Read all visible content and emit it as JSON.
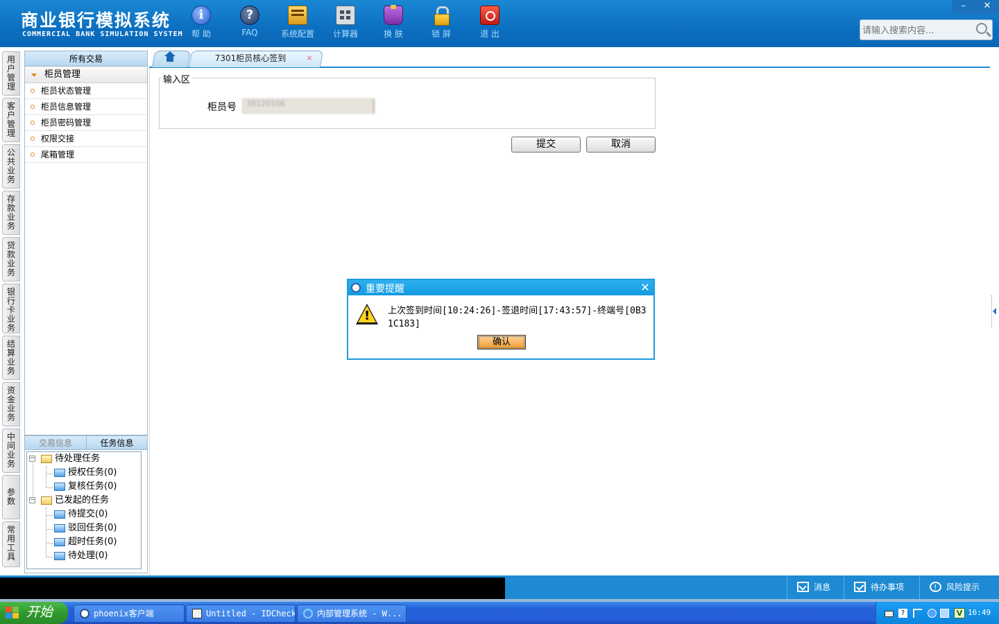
{
  "header": {
    "logo_cn": "商业银行模拟系统",
    "logo_en": "COMMERCIAL BANK SIMULATION SYSTEM",
    "toolbar": [
      {
        "label": "帮 助",
        "icon": "info-icon"
      },
      {
        "label": "FAQ",
        "icon": "faq-icon"
      },
      {
        "label": "系统配置",
        "icon": "config-icon"
      },
      {
        "label": "计算器",
        "icon": "calculator-icon"
      },
      {
        "label": "换 肤",
        "icon": "skin-icon"
      },
      {
        "label": "锁 屏",
        "icon": "lock-icon"
      },
      {
        "label": "退 出",
        "icon": "exit-icon"
      }
    ],
    "window_min": "–",
    "window_close": "✕",
    "search_placeholder": "请输入搜索内容..."
  },
  "vnav": [
    "用户管理",
    "客户管理",
    "公共业务",
    "存款业务",
    "贷款业务",
    "银行卡业务",
    "结算业务",
    "资金业务",
    "中间业务",
    "参数",
    "常用工具"
  ],
  "left_panel": {
    "title": "所有交易",
    "group": "柜员管理",
    "items": [
      "柜员状态管理",
      "柜员信息管理",
      "柜员密码管理",
      "权限交接",
      "尾箱管理"
    ]
  },
  "left_bottom": {
    "tabs": [
      "交易信息",
      "任务信息"
    ],
    "tree": {
      "pending": "待处理任务",
      "pending_children": [
        "授权任务(0)",
        "复核任务(0)"
      ],
      "initiated": "已发起的任务",
      "initiated_children": [
        "待提交(0)",
        "驳回任务(0)",
        "超时任务(0)",
        "待处理(0)"
      ]
    }
  },
  "tabs": {
    "active": "7301柜员核心签到",
    "close": "×"
  },
  "form": {
    "section_title": "输入区",
    "teller_label": "柜员号",
    "teller_value": "38120106",
    "submit": "提交",
    "cancel": "取消"
  },
  "dialog": {
    "title": "重要提醒",
    "message": "上次签到时间[10:24:26]-签退时间[17:43:57]-终端号[0B31C183]",
    "ok": "确认",
    "close": "✕"
  },
  "statusbar": {
    "items": [
      "消息",
      "待办事项",
      "风险提示"
    ]
  },
  "taskbar": {
    "start": "开始",
    "tasks": [
      "phoenix客户端",
      "Untitled - IDCheck",
      "内部管理系统 - W..."
    ],
    "tray_v": "V",
    "tray_help": "?",
    "clock": "16:49"
  },
  "colors": {
    "header_blue": "#0c6fc0",
    "tab_line": "#1d8ad3",
    "dialog_border": "#1a9be0",
    "ok_button": "#f19a2c",
    "taskbar_blue": "#245edb",
    "start_green": "#2f9a2c"
  }
}
